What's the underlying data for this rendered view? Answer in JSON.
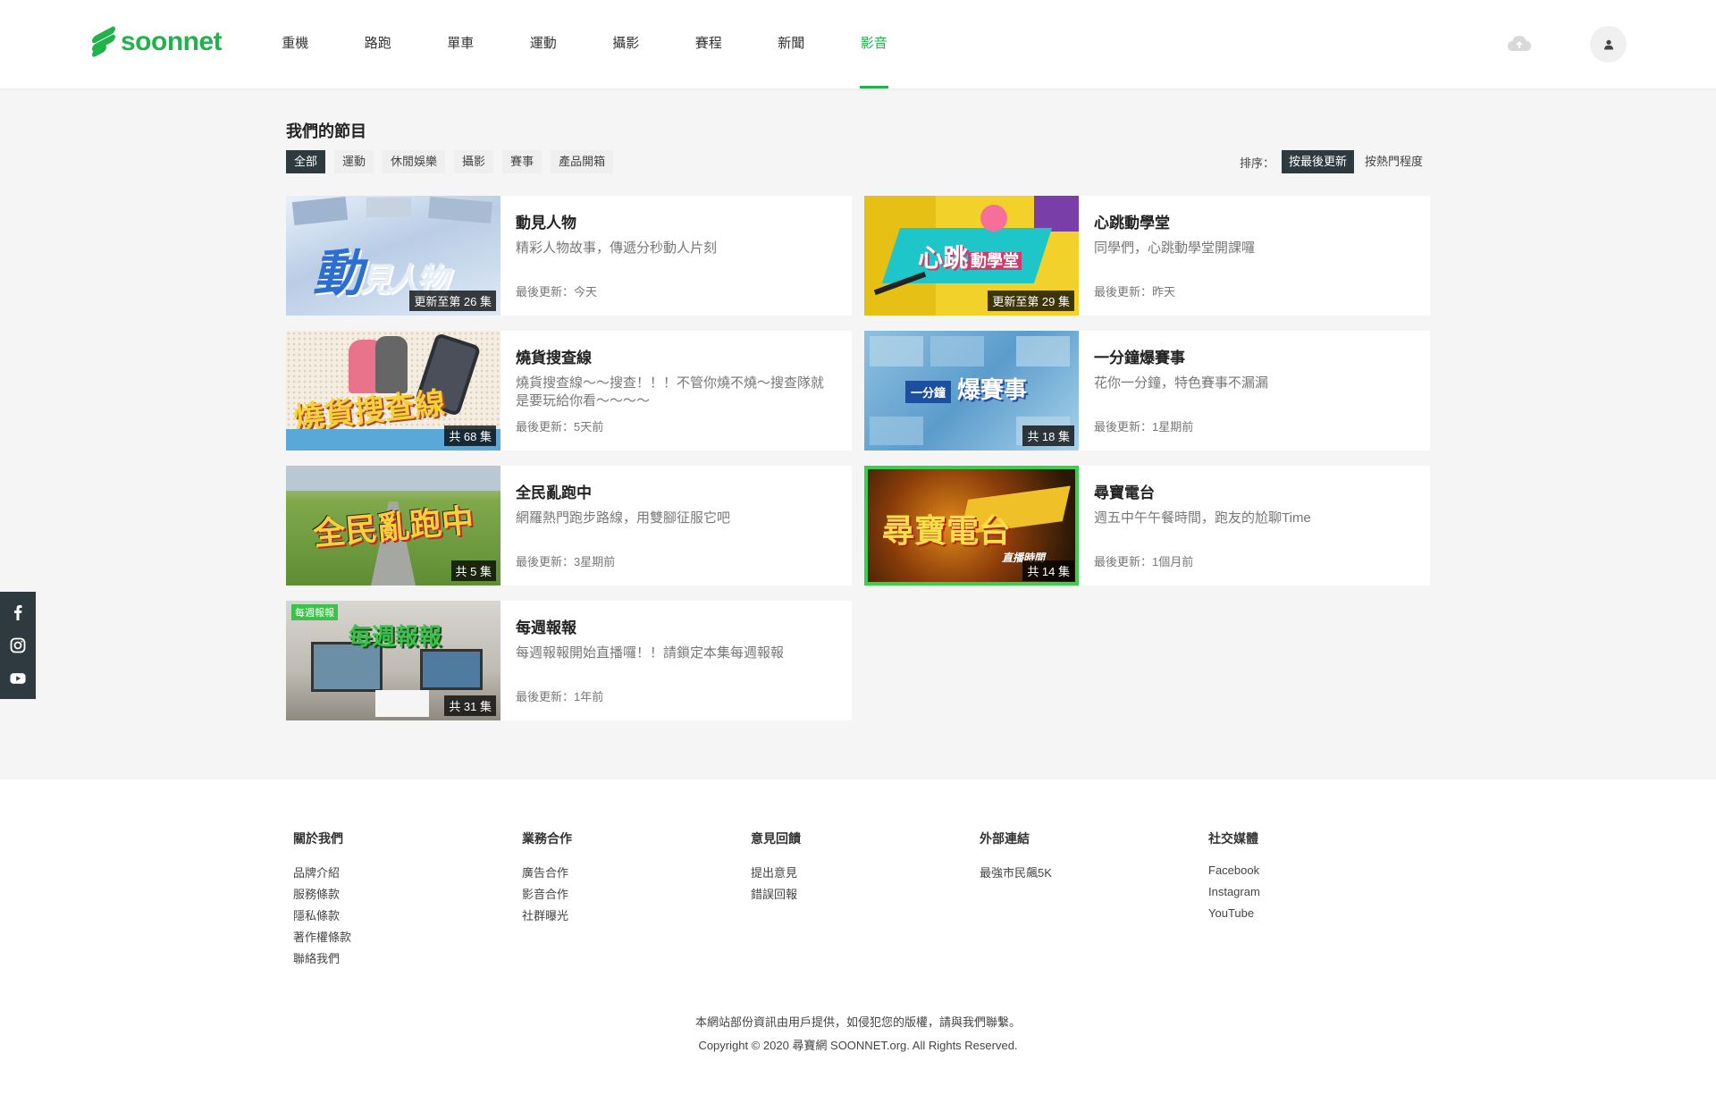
{
  "brand": {
    "name": "soonnet",
    "color": "#22b24c"
  },
  "nav": {
    "items": [
      "重機",
      "路跑",
      "單車",
      "運動",
      "攝影",
      "賽程",
      "新聞",
      "影音"
    ],
    "active": "影音"
  },
  "header": {
    "cloud_icon": "cloud-upload-icon",
    "avatar_icon": "user-icon"
  },
  "main": {
    "title": "我們的節目",
    "filters": [
      "全部",
      "運動",
      "休閒娛樂",
      "攝影",
      "賽事",
      "產品開箱"
    ],
    "active_filter": "全部",
    "sort": {
      "label": "排序：",
      "options": [
        "按最後更新",
        "按熱門程度"
      ],
      "active": "按最後更新"
    }
  },
  "programs": [
    {
      "title": "動見人物",
      "desc": "精彩人物故事，傳遞分秒動人片刻",
      "update": "最後更新：今天",
      "badge": "更新至第 26 集"
    },
    {
      "title": "心跳動學堂",
      "desc": "同學們，心跳動學堂開課囉",
      "update": "最後更新：昨天",
      "badge": "更新至第 29 集"
    },
    {
      "title": "燒貨搜查線",
      "desc": "燒貨搜查線～～搜查！！！不管你燒不燒～搜查隊就是要玩給你看～～～～",
      "update": "最後更新：5天前",
      "badge": "共 68 集"
    },
    {
      "title": "一分鐘爆賽事",
      "desc": "花你一分鐘，特色賽事不漏漏",
      "update": "最後更新：1星期前",
      "badge": "共 18 集"
    },
    {
      "title": "全民亂跑中",
      "desc": "網羅熱門跑步路線，用雙腳征服它吧",
      "update": "最後更新：3星期前",
      "badge": "共 5 集"
    },
    {
      "title": "尋寶電台",
      "desc": "週五中午午餐時間，跑友的尬聊Time",
      "update": "最後更新：1個月前",
      "badge": "共 14 集"
    },
    {
      "title": "每週報報",
      "desc": "每週報報開始直播囉！！請鎖定本集每週報報",
      "update": "最後更新：1年前",
      "badge": "共 31 集"
    }
  ],
  "side_social": [
    "facebook-icon",
    "instagram-icon",
    "youtube-icon"
  ],
  "footer": {
    "columns": [
      {
        "title": "關於我們",
        "links": [
          "品牌介紹",
          "服務條款",
          "隱私條款",
          "著作權條款",
          "聯絡我們"
        ]
      },
      {
        "title": "業務合作",
        "links": [
          "廣告合作",
          "影音合作",
          "社群曝光"
        ]
      },
      {
        "title": "意見回饋",
        "links": [
          "提出意見",
          "錯誤回報"
        ]
      },
      {
        "title": "外部連結",
        "links": [
          "最強市民飆5K"
        ]
      },
      {
        "title": "社交媒體",
        "links": [
          "Facebook",
          "Instagram",
          "YouTube"
        ]
      }
    ],
    "notice": "本網站部份資訊由用戶提供，如侵犯您的版權，請與我們聯繫。",
    "copyright": "Copyright © 2020 尋寶網 SOONNET.org. All Rights Reserved."
  }
}
